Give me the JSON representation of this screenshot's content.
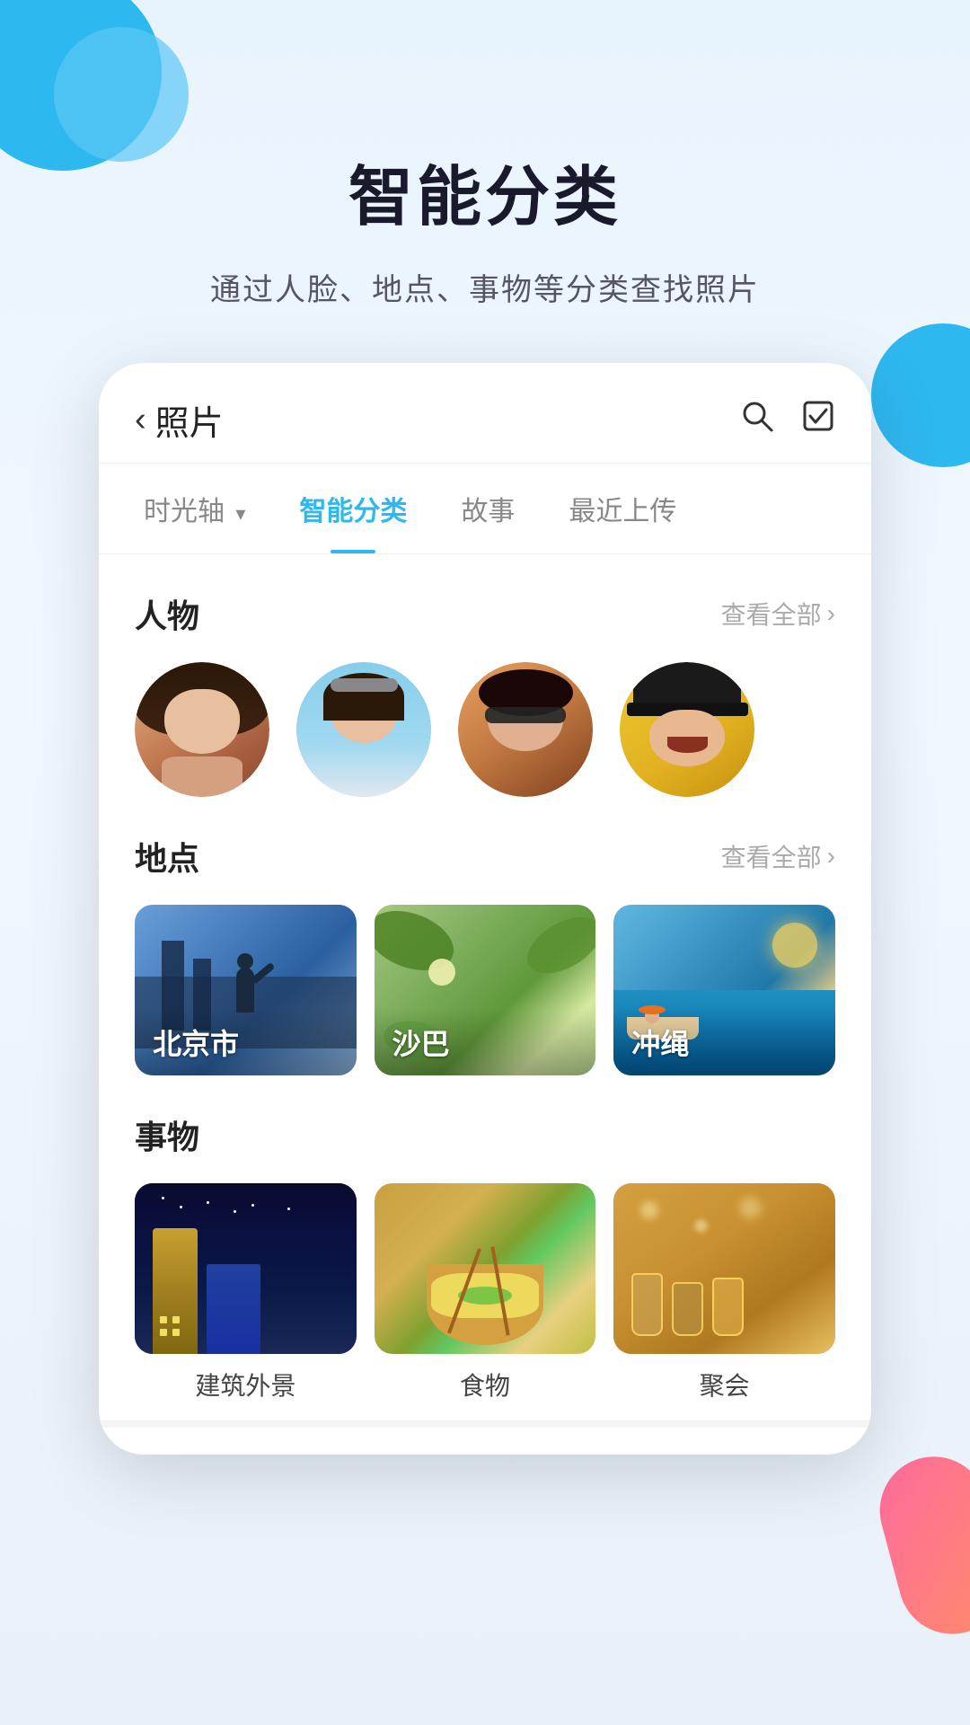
{
  "header": {
    "main_title": "智能分类",
    "sub_title": "通过人脸、地点、事物等分类查找照片"
  },
  "nav": {
    "back_label": "照片",
    "search_icon": "🔍",
    "select_icon": "☑"
  },
  "tabs": [
    {
      "label": "时光轴",
      "has_arrow": true,
      "active": false
    },
    {
      "label": "智能分类",
      "has_arrow": false,
      "active": true
    },
    {
      "label": "故事",
      "has_arrow": false,
      "active": false
    },
    {
      "label": "最近上传",
      "has_arrow": false,
      "active": false
    }
  ],
  "sections": {
    "people": {
      "title": "人物",
      "view_all": "查看全部",
      "avatars": [
        {
          "id": 1,
          "style": "avatar-1"
        },
        {
          "id": 2,
          "style": "avatar-2"
        },
        {
          "id": 3,
          "style": "avatar-3"
        },
        {
          "id": 4,
          "style": "avatar-4"
        }
      ]
    },
    "places": {
      "title": "地点",
      "view_all": "查看全部",
      "cards": [
        {
          "label": "北京市",
          "style": "place-beijing"
        },
        {
          "label": "沙巴",
          "style": "place-saba"
        },
        {
          "label": "冲绳",
          "style": "place-okinawa"
        }
      ]
    },
    "things": {
      "title": "事物",
      "cards": [
        {
          "label": "建筑外景",
          "style": "thing-architecture"
        },
        {
          "label": "食物",
          "style": "thing-food"
        },
        {
          "label": "聚会",
          "style": "thing-party"
        }
      ]
    }
  }
}
